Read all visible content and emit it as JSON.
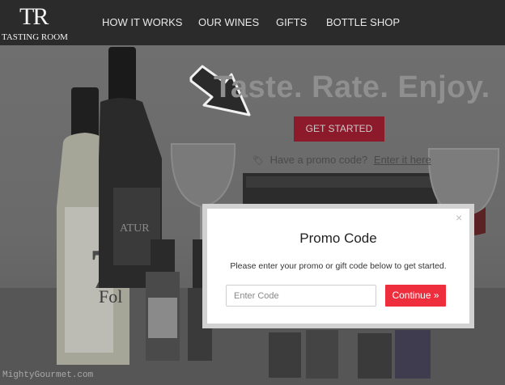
{
  "brand": {
    "logo_mark": "TR",
    "logo_text": "TASTING ROOM"
  },
  "nav": {
    "items": [
      {
        "label": "HOW IT WORKS"
      },
      {
        "label": "OUR WINES"
      },
      {
        "label": "GIFTS"
      },
      {
        "label": "BOTTLE SHOP"
      }
    ]
  },
  "hero": {
    "headline": "Taste. Rate. Enjoy.",
    "cta_label": "GET STARTED",
    "promo_prompt": "Have a promo code?",
    "promo_link": "Enter it here"
  },
  "modal": {
    "close_glyph": "×",
    "title": "Promo Code",
    "subtitle": "Please enter your promo or gift code below to get started.",
    "input_placeholder": "Enter Code",
    "input_value": "",
    "continue_label": "Continue »"
  },
  "watermark": "MightyGourmet.com",
  "colors": {
    "nav_bg": "#2b2b2b",
    "cta_dimmed": "#8c1a2b",
    "continue_red": "#ee2e3d",
    "overlay_gray": "#6f6f6f"
  },
  "icons": [
    "price-tag-icon",
    "close-icon",
    "annotation-arrow-icon"
  ]
}
